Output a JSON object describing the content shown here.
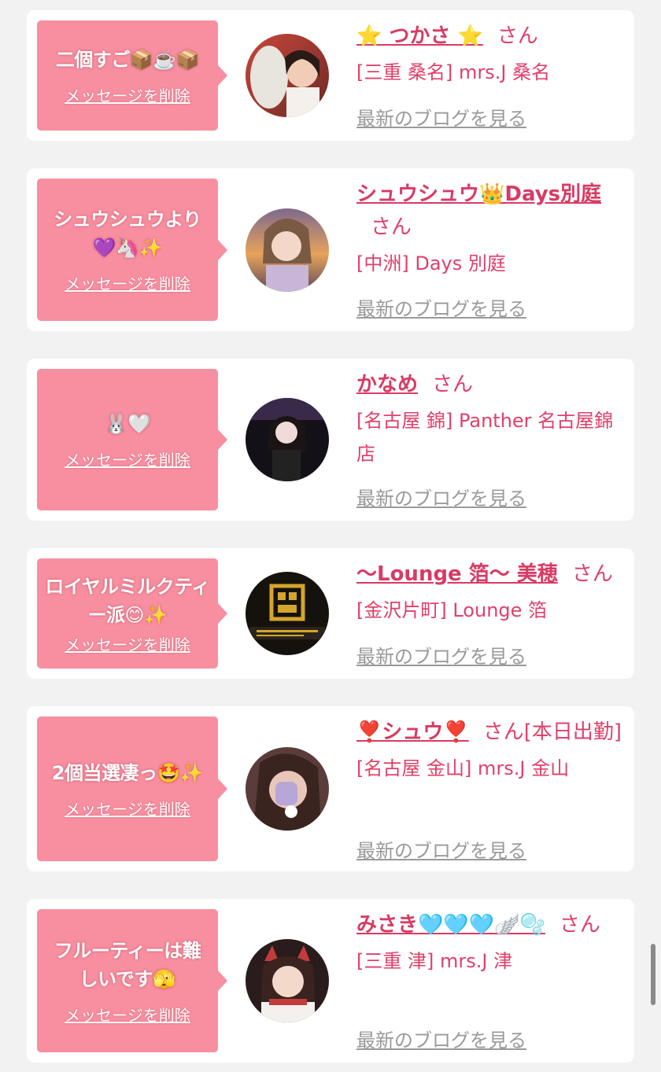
{
  "cards": [
    {
      "message": "二個すご📦☕️📦",
      "delete_label": "メッセージを削除",
      "name": "⭐️ つかさ ⭐️",
      "honorific": "さん",
      "shop": "[三重 桑名] mrs.J 桑名",
      "blog_label": "最新のブログを見る",
      "avatar_icon": "avatar-photo"
    },
    {
      "message": "シュウシュウより💜🦄✨",
      "delete_label": "メッセージを削除",
      "name": "シュウシュウ👑Days別庭",
      "honorific": "さん",
      "shop": "[中洲] Days 別庭",
      "blog_label": "最新のブログを見る",
      "avatar_icon": "avatar-photo"
    },
    {
      "message": "🐰🤍",
      "delete_label": "メッセージを削除",
      "name": "かなめ",
      "honorific": "さん",
      "shop": "[名古屋 錦] Panther 名古屋錦店",
      "blog_label": "最新のブログを見る",
      "avatar_icon": "avatar-photo"
    },
    {
      "message": "ロイヤルミルクティー派😊✨",
      "delete_label": "メッセージを削除",
      "name": "〜Lounge 箔〜 美穂",
      "honorific": "さん",
      "shop": "[金沢片町] Lounge 箔",
      "blog_label": "最新のブログを見る",
      "avatar_icon": "lounge-logo"
    },
    {
      "message": "2個当選凄っ🤩✨",
      "delete_label": "メッセージを削除",
      "name": "❣️シュウ❣️",
      "honorific": "さん[本日出勤]",
      "shop": "[名古屋 金山] mrs.J 金山",
      "blog_label": "最新のブログを見る",
      "avatar_icon": "avatar-photo"
    },
    {
      "message": "フルーティーは難しいです🫣",
      "delete_label": "メッセージを削除",
      "name": "みさき🩵🩵🩵🪽🫧",
      "honorific": "さん",
      "shop": "[三重 津] mrs.J 津",
      "blog_label": "最新のブログを見る",
      "avatar_icon": "avatar-photo"
    }
  ],
  "colors": {
    "bubble": "#f88fa0",
    "name": "#d83b64",
    "text": "#e0406a",
    "blog": "#9a9a9a",
    "background": "#f2f2f2"
  }
}
